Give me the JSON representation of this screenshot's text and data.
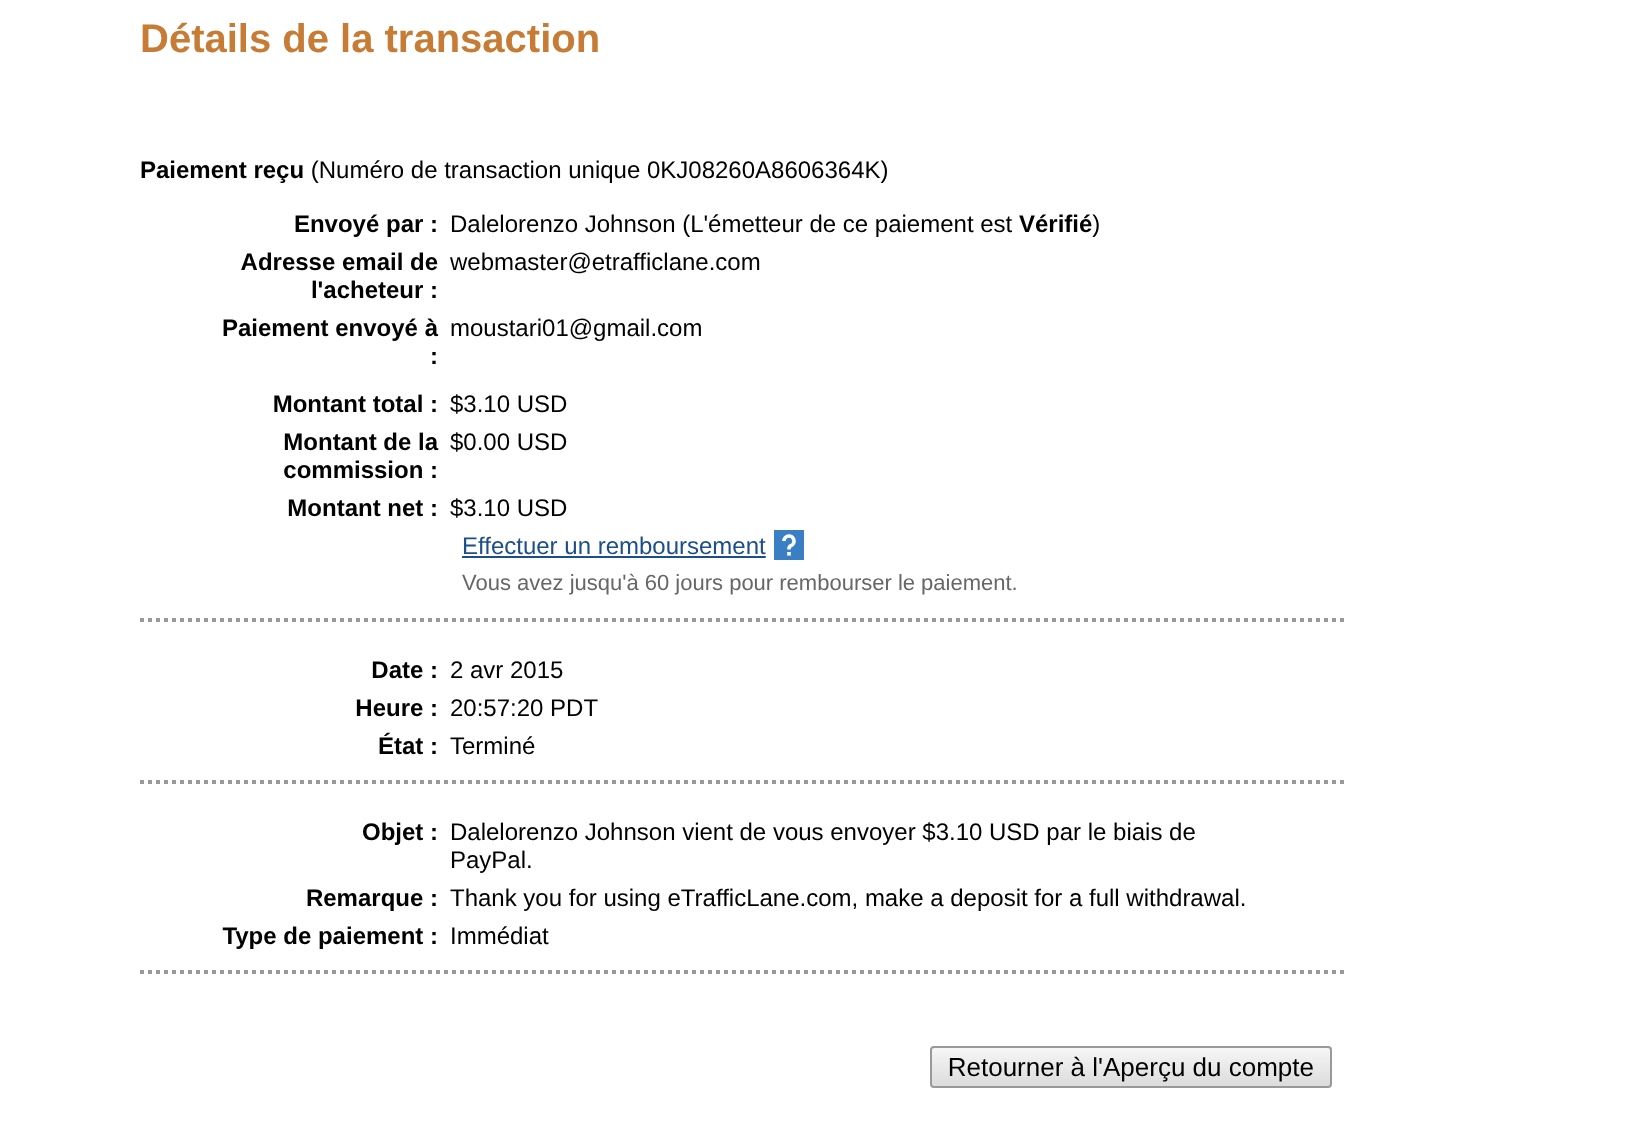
{
  "title": "Détails de la transaction",
  "received": {
    "label": "Paiement reçu",
    "text": "(Numéro de transaction unique 0KJ08260A8606364K)"
  },
  "sections": [
    {
      "groups": [
        [
          {
            "label": "Envoyé par :",
            "value": "Dalelorenzo Johnson (L'émetteur de ce paiement est **Vérifié**)"
          },
          {
            "label": "Adresse email de l'acheteur :",
            "value": "webmaster@etrafficlane.com"
          },
          {
            "label": "Paiement envoyé à :",
            "value": "moustari01@gmail.com"
          }
        ],
        [
          {
            "label": "Montant total :",
            "value": "$3.10 USD"
          },
          {
            "label": "Montant de la commission :",
            "value": "$0.00 USD"
          },
          {
            "label": "Montant net :",
            "value": "$3.10 USD"
          }
        ]
      ],
      "refund": {
        "link": "Effectuer un remboursement",
        "note": "Vous avez jusqu'à 60 jours pour rembourser le paiement."
      }
    },
    {
      "groups": [
        [
          {
            "label": "Date :",
            "value": "2 avr 2015"
          },
          {
            "label": "Heure :",
            "value": "20:57:20 PDT"
          },
          {
            "label": "État :",
            "value": "Terminé"
          }
        ]
      ]
    },
    {
      "groups": [
        [
          {
            "label": "Objet :",
            "value": "Dalelorenzo Johnson vient de vous envoyer $3.10 USD par le biais de PayPal."
          },
          {
            "label": "Remarque :",
            "value": "Thank you for using eTrafficLane.com, make a deposit for a full withdrawal."
          },
          {
            "label": "Type de paiement :",
            "value": "Immédiat"
          }
        ]
      ]
    }
  ],
  "button": "Retourner à l'Aperçu du compte"
}
